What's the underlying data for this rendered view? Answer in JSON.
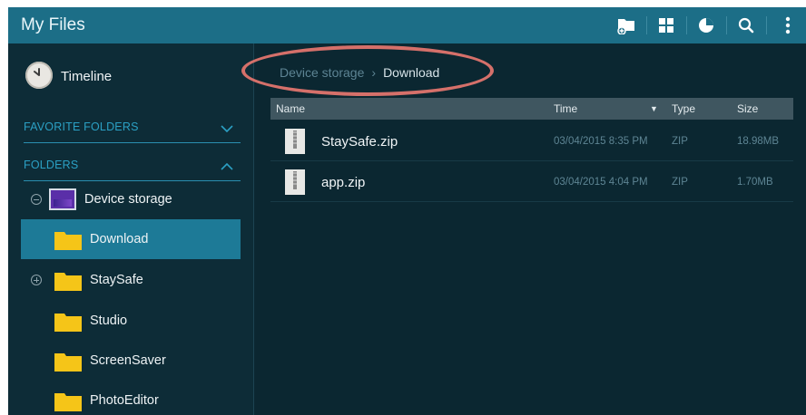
{
  "app": {
    "title": "My Files"
  },
  "toolbar_icons": [
    "new-folder-icon",
    "grid-view-icon",
    "storage-usage-icon",
    "search-icon",
    "more-options-icon"
  ],
  "sidebar": {
    "timeline_label": "Timeline",
    "favorite_folders_label": "FAVORITE FOLDERS",
    "folders_label": "FOLDERS",
    "device_storage_label": "Device storage",
    "folders": [
      {
        "label": "Download",
        "selected": true
      },
      {
        "label": "StaySafe"
      },
      {
        "label": "Studio"
      },
      {
        "label": "ScreenSaver"
      },
      {
        "label": "PhotoEditor"
      }
    ]
  },
  "breadcrumb": {
    "root": "Device storage",
    "separator": "›",
    "current": "Download"
  },
  "table": {
    "headers": {
      "name": "Name",
      "time": "Time",
      "type": "Type",
      "size": "Size"
    },
    "sort_indicator": "▼",
    "rows": [
      {
        "name": "StaySafe.zip",
        "time": "03/04/2015 8:35 PM",
        "type": "ZIP",
        "size": "18.98MB"
      },
      {
        "name": "app.zip",
        "time": "03/04/2015 4:04 PM",
        "type": "ZIP",
        "size": "1.70MB"
      }
    ]
  },
  "colors": {
    "titlebar": "#1c6e87",
    "background": "#0b2731",
    "selected_row": "#1d7a97",
    "section_accent": "#2ba0c4",
    "folder_yellow": "#f5c518",
    "annotation_circle": "#d5706a"
  }
}
